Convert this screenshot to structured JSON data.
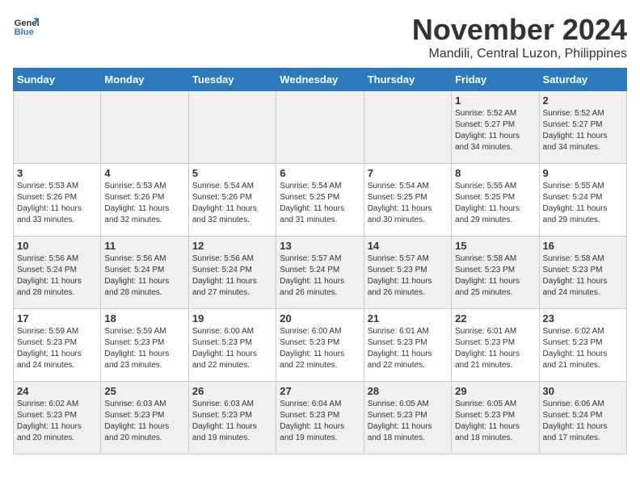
{
  "logo": {
    "general": "General",
    "blue": "Blue"
  },
  "title": "November 2024",
  "subtitle": "Mandili, Central Luzon, Philippines",
  "days_header": [
    "Sunday",
    "Monday",
    "Tuesday",
    "Wednesday",
    "Thursday",
    "Friday",
    "Saturday"
  ],
  "weeks": [
    [
      {
        "day": "",
        "info": ""
      },
      {
        "day": "",
        "info": ""
      },
      {
        "day": "",
        "info": ""
      },
      {
        "day": "",
        "info": ""
      },
      {
        "day": "",
        "info": ""
      },
      {
        "day": "1",
        "info": "Sunrise: 5:52 AM\nSunset: 5:27 PM\nDaylight: 11 hours\nand 34 minutes."
      },
      {
        "day": "2",
        "info": "Sunrise: 5:52 AM\nSunset: 5:27 PM\nDaylight: 11 hours\nand 34 minutes."
      }
    ],
    [
      {
        "day": "3",
        "info": "Sunrise: 5:53 AM\nSunset: 5:26 PM\nDaylight: 11 hours\nand 33 minutes."
      },
      {
        "day": "4",
        "info": "Sunrise: 5:53 AM\nSunset: 5:26 PM\nDaylight: 11 hours\nand 32 minutes."
      },
      {
        "day": "5",
        "info": "Sunrise: 5:54 AM\nSunset: 5:26 PM\nDaylight: 11 hours\nand 32 minutes."
      },
      {
        "day": "6",
        "info": "Sunrise: 5:54 AM\nSunset: 5:25 PM\nDaylight: 11 hours\nand 31 minutes."
      },
      {
        "day": "7",
        "info": "Sunrise: 5:54 AM\nSunset: 5:25 PM\nDaylight: 11 hours\nand 30 minutes."
      },
      {
        "day": "8",
        "info": "Sunrise: 5:55 AM\nSunset: 5:25 PM\nDaylight: 11 hours\nand 29 minutes."
      },
      {
        "day": "9",
        "info": "Sunrise: 5:55 AM\nSunset: 5:24 PM\nDaylight: 11 hours\nand 29 minutes."
      }
    ],
    [
      {
        "day": "10",
        "info": "Sunrise: 5:56 AM\nSunset: 5:24 PM\nDaylight: 11 hours\nand 28 minutes."
      },
      {
        "day": "11",
        "info": "Sunrise: 5:56 AM\nSunset: 5:24 PM\nDaylight: 11 hours\nand 28 minutes."
      },
      {
        "day": "12",
        "info": "Sunrise: 5:56 AM\nSunset: 5:24 PM\nDaylight: 11 hours\nand 27 minutes."
      },
      {
        "day": "13",
        "info": "Sunrise: 5:57 AM\nSunset: 5:24 PM\nDaylight: 11 hours\nand 26 minutes."
      },
      {
        "day": "14",
        "info": "Sunrise: 5:57 AM\nSunset: 5:23 PM\nDaylight: 11 hours\nand 26 minutes."
      },
      {
        "day": "15",
        "info": "Sunrise: 5:58 AM\nSunset: 5:23 PM\nDaylight: 11 hours\nand 25 minutes."
      },
      {
        "day": "16",
        "info": "Sunrise: 5:58 AM\nSunset: 5:23 PM\nDaylight: 11 hours\nand 24 minutes."
      }
    ],
    [
      {
        "day": "17",
        "info": "Sunrise: 5:59 AM\nSunset: 5:23 PM\nDaylight: 11 hours\nand 24 minutes."
      },
      {
        "day": "18",
        "info": "Sunrise: 5:59 AM\nSunset: 5:23 PM\nDaylight: 11 hours\nand 23 minutes."
      },
      {
        "day": "19",
        "info": "Sunrise: 6:00 AM\nSunset: 5:23 PM\nDaylight: 11 hours\nand 22 minutes."
      },
      {
        "day": "20",
        "info": "Sunrise: 6:00 AM\nSunset: 5:23 PM\nDaylight: 11 hours\nand 22 minutes."
      },
      {
        "day": "21",
        "info": "Sunrise: 6:01 AM\nSunset: 5:23 PM\nDaylight: 11 hours\nand 22 minutes."
      },
      {
        "day": "22",
        "info": "Sunrise: 6:01 AM\nSunset: 5:23 PM\nDaylight: 11 hours\nand 21 minutes."
      },
      {
        "day": "23",
        "info": "Sunrise: 6:02 AM\nSunset: 5:23 PM\nDaylight: 11 hours\nand 21 minutes."
      }
    ],
    [
      {
        "day": "24",
        "info": "Sunrise: 6:02 AM\nSunset: 5:23 PM\nDaylight: 11 hours\nand 20 minutes."
      },
      {
        "day": "25",
        "info": "Sunrise: 6:03 AM\nSunset: 5:23 PM\nDaylight: 11 hours\nand 20 minutes."
      },
      {
        "day": "26",
        "info": "Sunrise: 6:03 AM\nSunset: 5:23 PM\nDaylight: 11 hours\nand 19 minutes."
      },
      {
        "day": "27",
        "info": "Sunrise: 6:04 AM\nSunset: 5:23 PM\nDaylight: 11 hours\nand 19 minutes."
      },
      {
        "day": "28",
        "info": "Sunrise: 6:05 AM\nSunset: 5:23 PM\nDaylight: 11 hours\nand 18 minutes."
      },
      {
        "day": "29",
        "info": "Sunrise: 6:05 AM\nSunset: 5:23 PM\nDaylight: 11 hours\nand 18 minutes."
      },
      {
        "day": "30",
        "info": "Sunrise: 6:06 AM\nSunset: 5:24 PM\nDaylight: 11 hours\nand 17 minutes."
      }
    ]
  ]
}
